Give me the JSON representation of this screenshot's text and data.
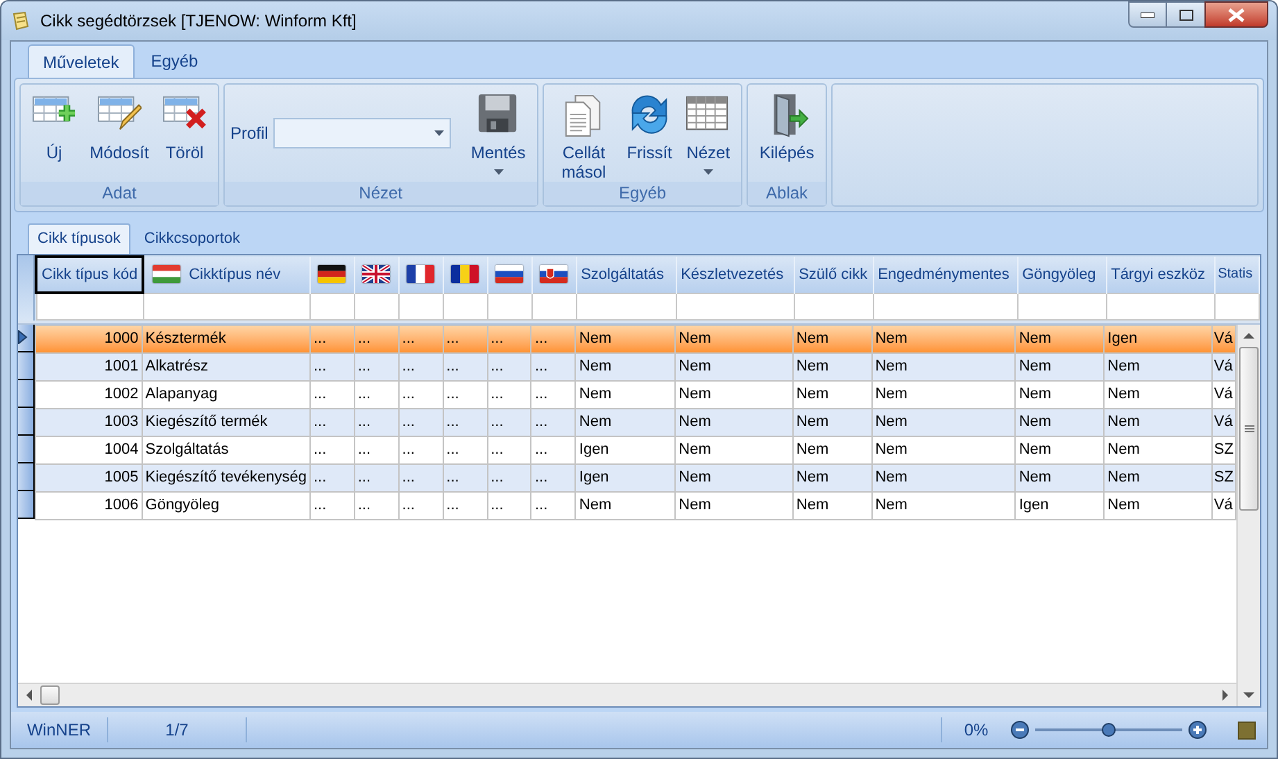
{
  "window": {
    "title": "Cikk segédtörzsek [TJENOW: Winform Kft]"
  },
  "ribbon_tabs": [
    {
      "label": "Műveletek",
      "selected": true
    },
    {
      "label": "Egyéb",
      "selected": false
    }
  ],
  "ribbon_groups": [
    {
      "title": "Adat",
      "items": [
        {
          "kind": "button",
          "label": "Új",
          "dropdown": false
        },
        {
          "kind": "button",
          "label": "Módosít",
          "dropdown": false
        },
        {
          "kind": "button",
          "label": "Töröl",
          "dropdown": false
        }
      ]
    },
    {
      "title": "Nézet",
      "items": [
        {
          "kind": "combo",
          "label": "Profil"
        },
        {
          "kind": "button",
          "label": "Mentés",
          "dropdown": true
        }
      ]
    },
    {
      "title": "Egyéb",
      "items": [
        {
          "kind": "button",
          "label": "Cellát másol",
          "dropdown": false
        },
        {
          "kind": "button",
          "label": "Frissít",
          "dropdown": false
        },
        {
          "kind": "button",
          "label": "Nézet",
          "dropdown": true
        }
      ]
    },
    {
      "title": "Ablak",
      "items": [
        {
          "kind": "button",
          "label": "Kilépés",
          "dropdown": false
        }
      ]
    }
  ],
  "sub_tabs": [
    {
      "label": "Cikk típusok",
      "selected": true
    },
    {
      "label": "Cikkcsoportok",
      "selected": false
    }
  ],
  "table": {
    "columns": [
      {
        "kind": "number",
        "label": "Cikk típus kód"
      },
      {
        "kind": "flag-text",
        "label": "Cikktípus név"
      },
      {
        "kind": "flag"
      },
      {
        "kind": "flag"
      },
      {
        "kind": "flag"
      },
      {
        "kind": "flag"
      },
      {
        "kind": "flag"
      },
      {
        "kind": "flag"
      },
      {
        "kind": "text",
        "label": "Szolgáltatás"
      },
      {
        "kind": "text",
        "label": "Készletvezetés"
      },
      {
        "kind": "text",
        "label": "Szülő cikk"
      },
      {
        "kind": "text",
        "label": "Engedménymentes"
      },
      {
        "kind": "text",
        "label": "Göngyöleg"
      },
      {
        "kind": "text",
        "label": "Tárgyi eszköz"
      },
      {
        "kind": "text",
        "label": "Statis"
      }
    ],
    "rows": [
      {
        "selected": true,
        "cells": [
          "1000",
          "Késztermék",
          "...",
          "...",
          "...",
          "...",
          "...",
          "...",
          "Nem",
          "Nem",
          "Nem",
          "Nem",
          "Nem",
          "Igen",
          "Vá"
        ]
      },
      {
        "selected": false,
        "cells": [
          "1001",
          "Alkatrész",
          "...",
          "...",
          "...",
          "...",
          "...",
          "...",
          "Nem",
          "Nem",
          "Nem",
          "Nem",
          "Nem",
          "Nem",
          "Vá"
        ]
      },
      {
        "selected": false,
        "cells": [
          "1002",
          "Alapanyag",
          "...",
          "...",
          "...",
          "...",
          "...",
          "...",
          "Nem",
          "Nem",
          "Nem",
          "Nem",
          "Nem",
          "Nem",
          "Vá"
        ]
      },
      {
        "selected": false,
        "cells": [
          "1003",
          "Kiegészítő termék",
          "...",
          "...",
          "...",
          "...",
          "...",
          "...",
          "Nem",
          "Nem",
          "Nem",
          "Nem",
          "Nem",
          "Nem",
          "Vá"
        ]
      },
      {
        "selected": false,
        "cells": [
          "1004",
          "Szolgáltatás",
          "...",
          "...",
          "...",
          "...",
          "...",
          "...",
          "Igen",
          "Nem",
          "Nem",
          "Nem",
          "Nem",
          "Nem",
          "SZ"
        ]
      },
      {
        "selected": false,
        "cells": [
          "1005",
          "Kiegészítő tevékenység",
          "...",
          "...",
          "...",
          "...",
          "...",
          "...",
          "Igen",
          "Nem",
          "Nem",
          "Nem",
          "Nem",
          "Nem",
          "SZ"
        ]
      },
      {
        "selected": false,
        "cells": [
          "1006",
          "Göngyöleg",
          "...",
          "...",
          "...",
          "...",
          "...",
          "...",
          "Nem",
          "Nem",
          "Nem",
          "Nem",
          "Igen",
          "Nem",
          "Vá"
        ]
      }
    ]
  },
  "status_bar": {
    "app": "WinNER",
    "record": "1/7",
    "zoom_text": "0%",
    "zoom": {
      "level": 0.5
    }
  }
}
